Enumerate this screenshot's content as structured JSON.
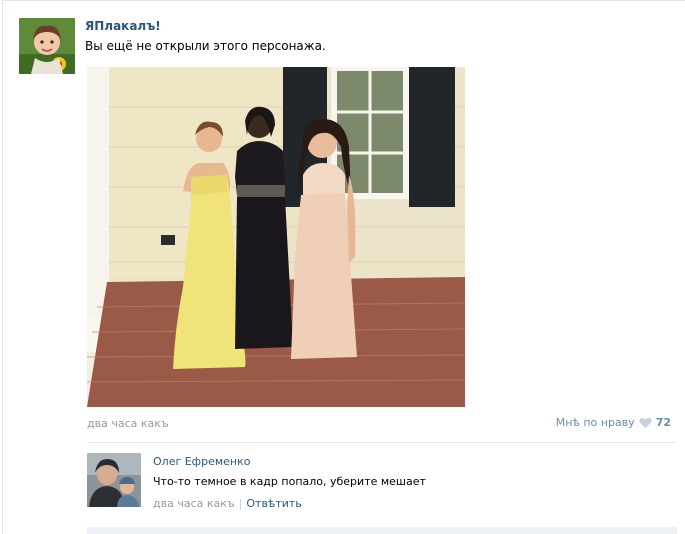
{
  "post": {
    "author": "ЯПлакалъ!",
    "text": "Вы ещё не открыли этого персонажа.",
    "time": "два часа какъ",
    "like_label": "Мнѣ по нраву",
    "like_count": "72"
  },
  "comment": {
    "author": "Олег Ефременко",
    "text": "Что-то темное в кадр попало, уберите мешает",
    "time": "два часа какъ",
    "separator": "|",
    "reply_label": "Отвѣтить"
  },
  "icons": {
    "like": "heart-icon"
  },
  "colors": {
    "link": "#2b587a",
    "muted": "#999999",
    "like": "#6a8caf"
  }
}
